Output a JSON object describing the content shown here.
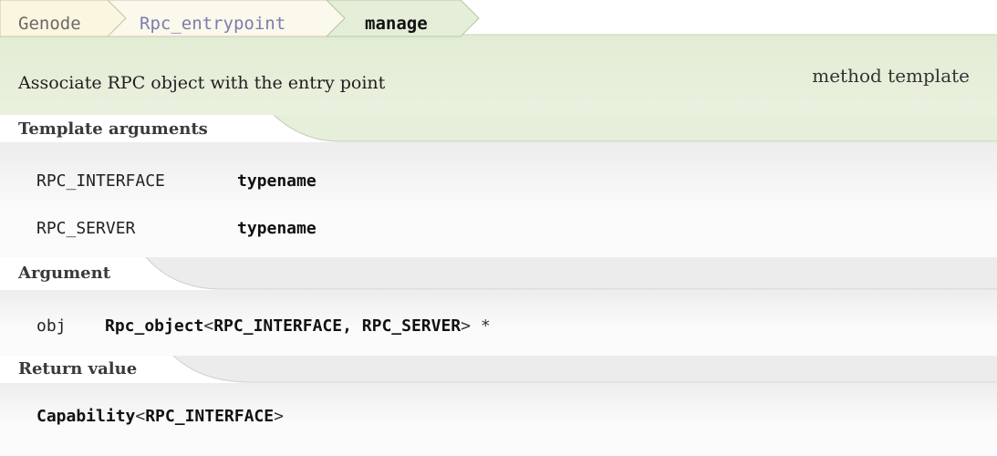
{
  "breadcrumb": {
    "items": [
      "Genode",
      "Rpc_entrypoint",
      "manage"
    ]
  },
  "description": "Associate RPC object with the entry point",
  "kind": "method template",
  "template_arguments": {
    "label": "Template arguments",
    "items": [
      {
        "name": "RPC_INTERFACE",
        "type": "typename"
      },
      {
        "name": "RPC_SERVER",
        "type": "typename"
      }
    ]
  },
  "argument": {
    "label": "Argument",
    "name": "obj",
    "type_base": "Rpc_object",
    "open": "<",
    "params": "RPC_INTERFACE, RPC_SERVER",
    "close": ">",
    "ptr": " *"
  },
  "return_value": {
    "label": "Return value",
    "type_base": "Capability",
    "open": "<",
    "param": "RPC_INTERFACE",
    "close": ">"
  },
  "colors": {
    "green_bg": "#e6efd9",
    "green_border": "#b9cca3",
    "tab_bg": "#fbf6df",
    "gray_top": "#ececec",
    "gray_bottom": "#f9f9f9"
  }
}
